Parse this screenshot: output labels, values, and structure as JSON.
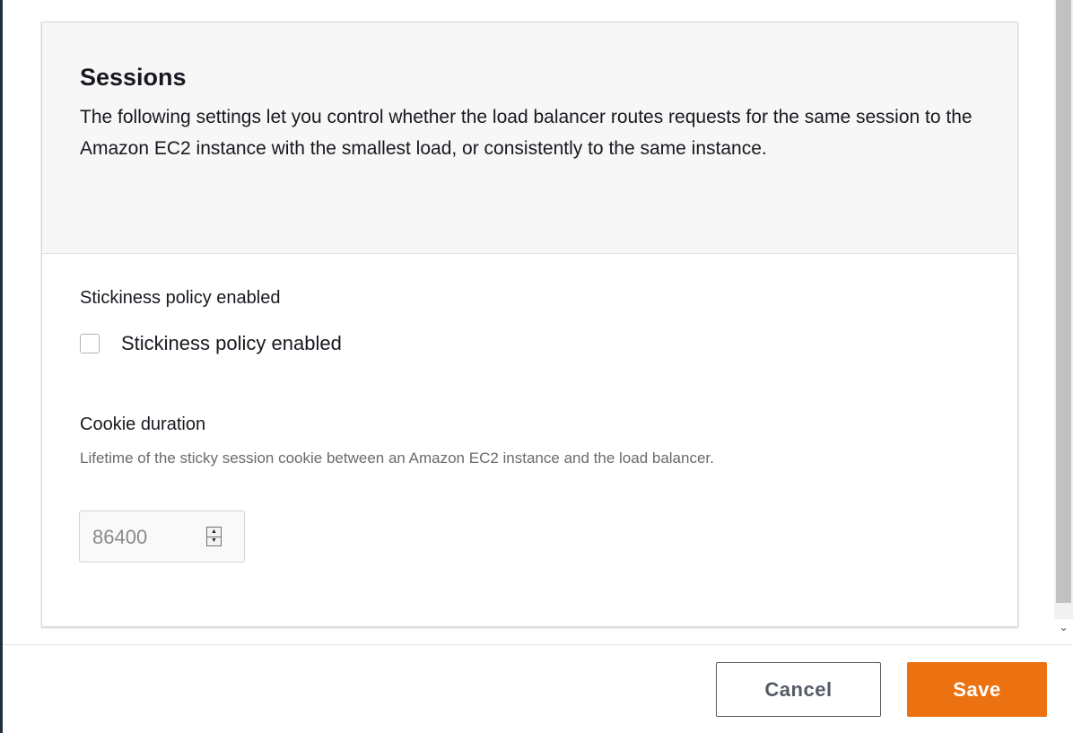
{
  "sessions": {
    "title": "Sessions",
    "description": "The following settings let you control whether the load balancer routes requests for the same session to the Amazon EC2 instance with the smallest load, or consistently to the same instance."
  },
  "stickiness": {
    "label": "Stickiness policy enabled",
    "checkbox_label": "Stickiness policy enabled",
    "checked": false
  },
  "cookie": {
    "label": "Cookie duration",
    "description": "Lifetime of the sticky session cookie between an Amazon EC2 instance and the load balancer.",
    "value": "86400"
  },
  "footer": {
    "cancel_label": "Cancel",
    "save_label": "Save"
  },
  "colors": {
    "primary_button": "#ec7211",
    "header_background": "#f7f7f7"
  }
}
